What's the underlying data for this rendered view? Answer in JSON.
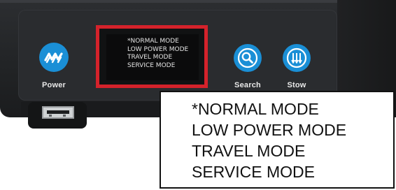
{
  "device": {
    "buttons": {
      "power": {
        "label": "Power",
        "icon": "antenna-signal-icon"
      },
      "search": {
        "label": "Search",
        "icon": "magnifier-icon"
      },
      "stow": {
        "label": "Stow",
        "icon": "stow-arrows-icon"
      }
    },
    "lcd_menu": [
      "*NORMAL MODE",
      "LOW POWER MODE",
      "TRAVEL MODE",
      "SERVICE MODE"
    ],
    "highlight_color": "#d4222b",
    "button_color": "#1a8fd6"
  },
  "callout": {
    "lines": [
      "*NORMAL MODE",
      "LOW POWER MODE",
      "TRAVEL MODE",
      "SERVICE MODE"
    ]
  }
}
